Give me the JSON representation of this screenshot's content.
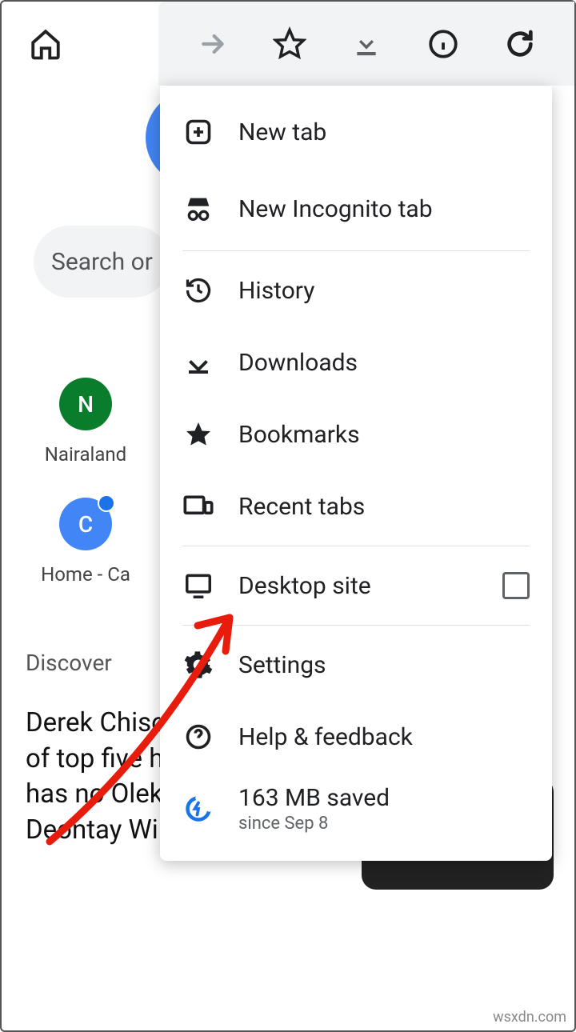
{
  "toolbar_icons": {
    "forward": "forward-icon",
    "bookmark": "star-icon",
    "download": "download-icon",
    "info": "info-icon",
    "reload": "reload-icon"
  },
  "search": {
    "placeholder": "Search or"
  },
  "shortcuts": [
    {
      "letter": "N",
      "label": "Nairaland",
      "color": "#0a7d2c"
    },
    {
      "letter": "C",
      "label": "Home - Ca",
      "color": "#4285f4"
    }
  ],
  "discover": {
    "heading": "Discover"
  },
  "article": {
    "text": "Derek Chisora's 'mental' list of top five heavyweights has no Oleksandr Usyk or Deontay Wilder"
  },
  "menu": {
    "new_tab": "New tab",
    "incognito": "New Incognito tab",
    "history": "History",
    "downloads": "Downloads",
    "bookmarks": "Bookmarks",
    "recent_tabs": "Recent tabs",
    "desktop_site": "Desktop site",
    "settings": "Settings",
    "help": "Help & feedback",
    "data_saved": "163 MB saved",
    "data_since": "since Sep 8"
  },
  "watermark": "wsxdn.com"
}
